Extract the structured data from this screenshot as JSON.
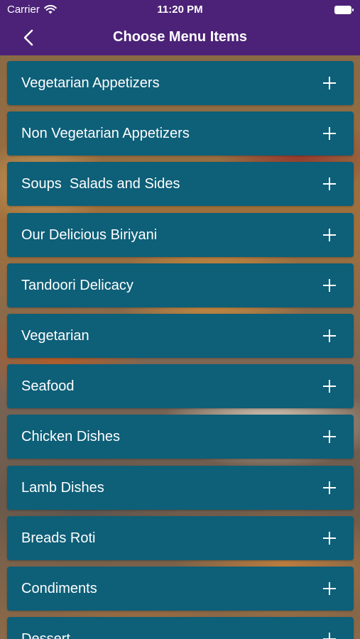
{
  "status_bar": {
    "carrier": "Carrier",
    "time": "11:20 PM"
  },
  "nav_bar": {
    "title": "Choose Menu Items",
    "back_icon": "chevron-left-icon"
  },
  "colors": {
    "header": "#4b2277",
    "item_background": "#0e5f78",
    "text": "#ffffff"
  },
  "menu_categories": [
    {
      "label": "Vegetarian Appetizers"
    },
    {
      "label": "Non Vegetarian Appetizers"
    },
    {
      "label": "Soups  Salads and Sides"
    },
    {
      "label": "Our Delicious Biriyani"
    },
    {
      "label": "Tandoori Delicacy"
    },
    {
      "label": "Vegetarian"
    },
    {
      "label": "Seafood"
    },
    {
      "label": "Chicken Dishes"
    },
    {
      "label": "Lamb Dishes"
    },
    {
      "label": "Breads Roti"
    },
    {
      "label": "Condiments"
    },
    {
      "label": "Dessert"
    }
  ]
}
